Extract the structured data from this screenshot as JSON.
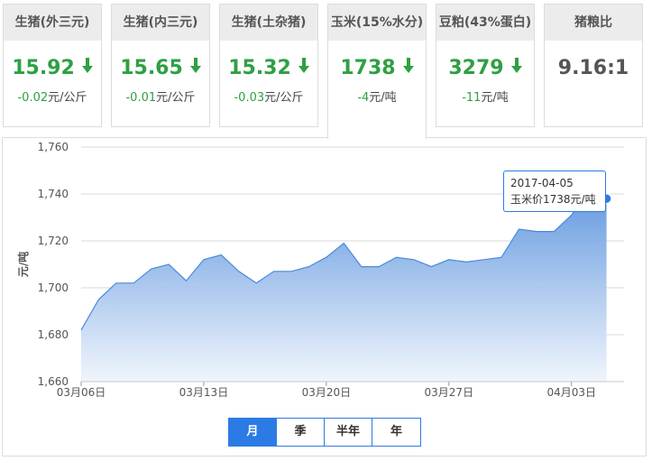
{
  "cards": [
    {
      "title": "生猪(外三元)",
      "price": "15.92",
      "change": "-0.02",
      "unit": "元/公斤",
      "trend": "down"
    },
    {
      "title": "生猪(内三元)",
      "price": "15.65",
      "change": "-0.01",
      "unit": "元/公斤",
      "trend": "down"
    },
    {
      "title": "生猪(土杂猪)",
      "price": "15.32",
      "change": "-0.03",
      "unit": "元/公斤",
      "trend": "down"
    },
    {
      "title": "玉米(15%水分)",
      "price": "1738",
      "change": "-4",
      "unit": "元/吨",
      "trend": "down",
      "active": true
    },
    {
      "title": "豆粕(43%蛋白)",
      "price": "3279",
      "change": "-11",
      "unit": "元/吨",
      "trend": "down"
    },
    {
      "title": "猪粮比",
      "price": "9.16:1"
    }
  ],
  "colors": {
    "down": "#2ea043",
    "accent": "#2c7be5",
    "area_top": "#5b93dd",
    "area_bottom": "#eef4fc",
    "line": "#4a89dc"
  },
  "tooltip": {
    "date": "2017-04-05",
    "text": "玉米价1738元/吨"
  },
  "range_tabs": [
    {
      "label": "月",
      "selected": true
    },
    {
      "label": "季"
    },
    {
      "label": "半年"
    },
    {
      "label": "年"
    }
  ],
  "chart_data": {
    "type": "area",
    "ylabel": "元/吨",
    "ylim": [
      1660,
      1760
    ],
    "yticks": [
      "1,660",
      "1,680",
      "1,700",
      "1,720",
      "1,740",
      "1,760"
    ],
    "xlim": [
      "2017-03-06",
      "2017-04-06"
    ],
    "xticks": [
      {
        "date": "2017-03-06",
        "label": "03月06日"
      },
      {
        "date": "2017-03-13",
        "label": "03月13日"
      },
      {
        "date": "2017-03-20",
        "label": "03月20日"
      },
      {
        "date": "2017-03-27",
        "label": "03月27日"
      },
      {
        "date": "2017-04-03",
        "label": "04月03日"
      }
    ],
    "grid": true,
    "x": [
      "2017-03-06",
      "2017-03-07",
      "2017-03-08",
      "2017-03-09",
      "2017-03-10",
      "2017-03-11",
      "2017-03-12",
      "2017-03-13",
      "2017-03-14",
      "2017-03-15",
      "2017-03-16",
      "2017-03-17",
      "2017-03-18",
      "2017-03-19",
      "2017-03-20",
      "2017-03-21",
      "2017-03-22",
      "2017-03-23",
      "2017-03-24",
      "2017-03-25",
      "2017-03-26",
      "2017-03-27",
      "2017-03-28",
      "2017-03-29",
      "2017-03-30",
      "2017-03-31",
      "2017-04-01",
      "2017-04-02",
      "2017-04-03",
      "2017-04-04",
      "2017-04-05"
    ],
    "values": [
      1682,
      1695,
      1702,
      1702,
      1708,
      1710,
      1703,
      1712,
      1714,
      1707,
      1702,
      1707,
      1707,
      1709,
      1713,
      1719,
      1709,
      1709,
      1713,
      1712,
      1709,
      1712,
      1711,
      1712,
      1713,
      1725,
      1724,
      1724,
      1731,
      1742,
      1738
    ],
    "highlight": "2017-04-05"
  }
}
